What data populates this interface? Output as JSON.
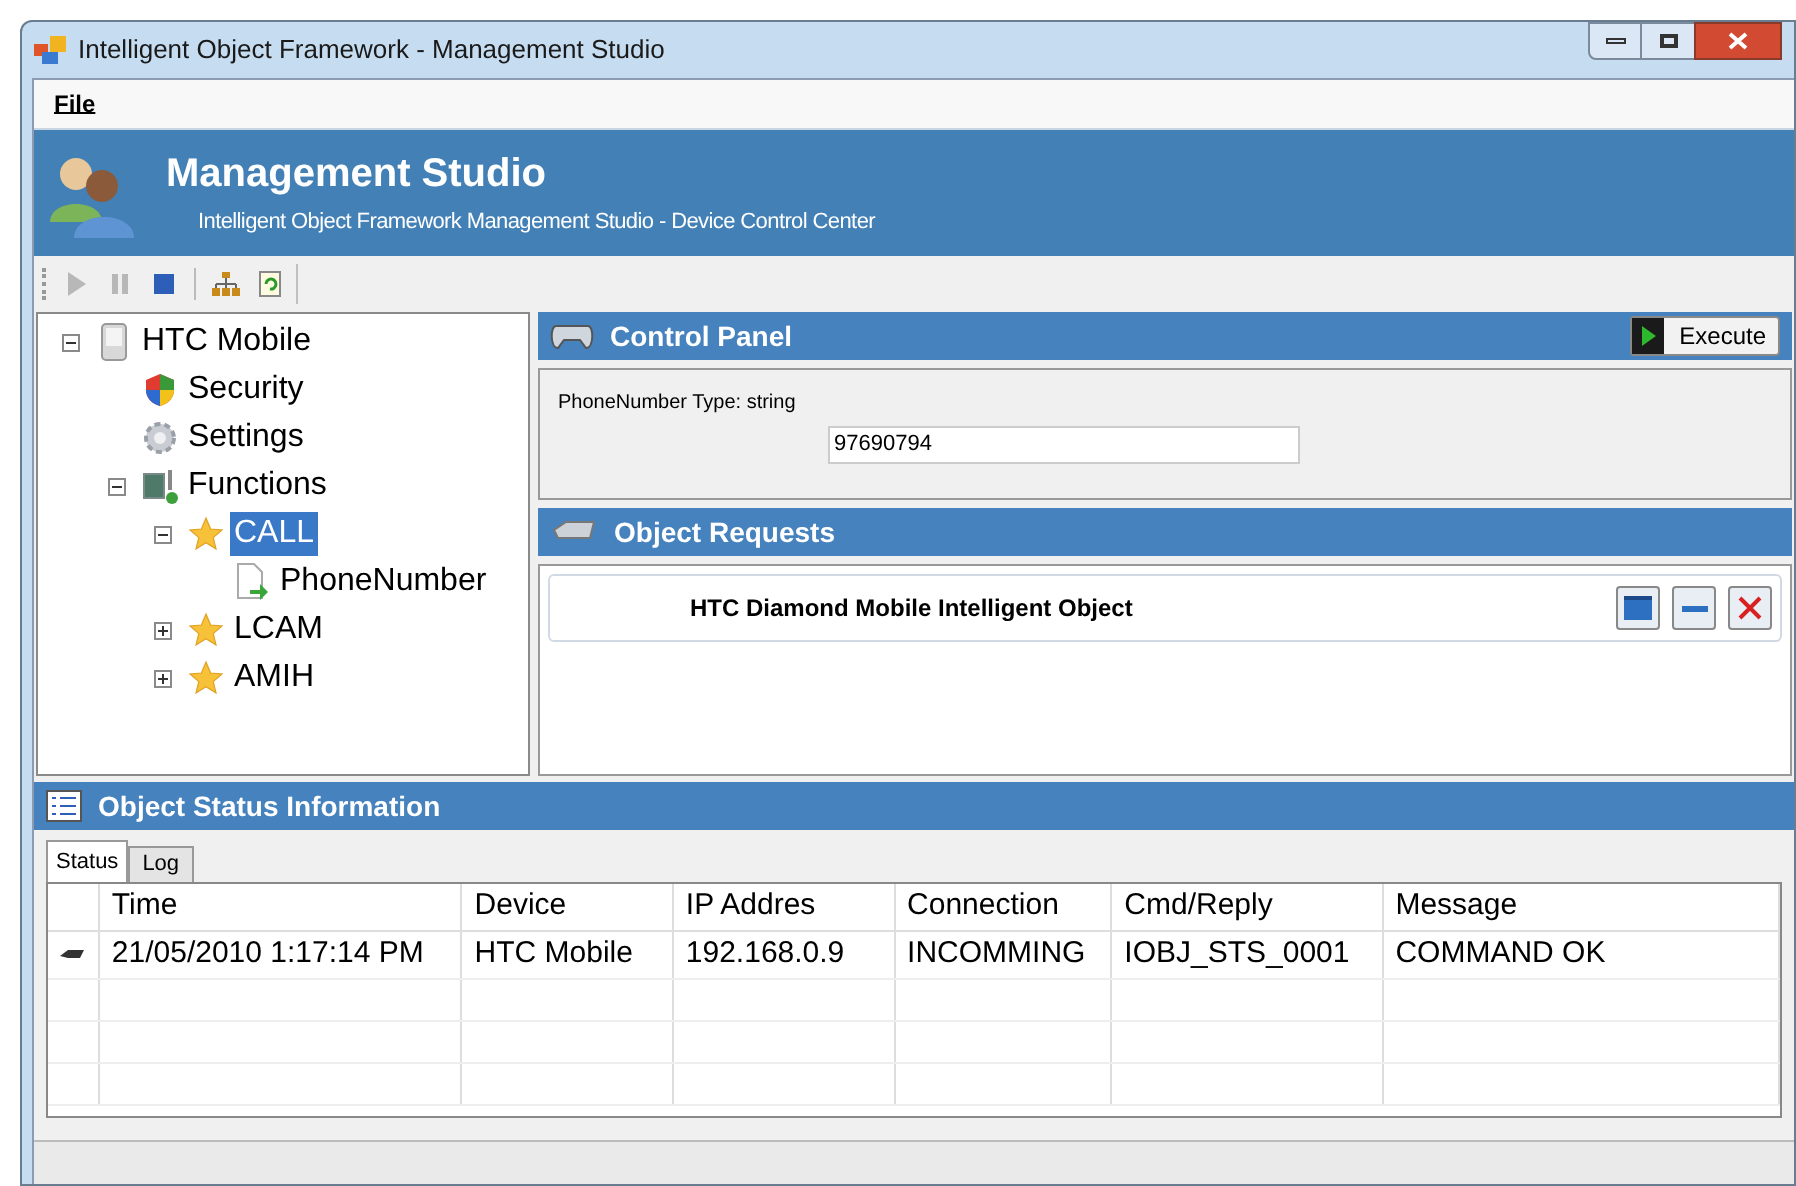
{
  "window": {
    "title": "Intelligent Object Framework - Management Studio"
  },
  "menu": [
    "File"
  ],
  "header": {
    "title": "Management Studio",
    "subtitle": "Intelligent Object Framework Management Studio - Device Control Center"
  },
  "toolbar": [
    {
      "kind": "play",
      "disabled": true
    },
    {
      "kind": "pause",
      "disabled": true
    },
    {
      "kind": "stop",
      "disabled": false
    },
    {
      "kind": "tree",
      "disabled": false
    },
    {
      "kind": "refresh",
      "disabled": false
    }
  ],
  "tree": [
    {
      "label": "HTC Mobile",
      "kind": "device",
      "expanded": true,
      "selected": false,
      "children": [
        {
          "label": "Security",
          "kind": "security",
          "selected": false
        },
        {
          "label": "Settings",
          "kind": "settings",
          "selected": false
        },
        {
          "label": "Functions",
          "kind": "functions",
          "expanded": true,
          "selected": false,
          "children": [
            {
              "label": "CALL",
              "kind": "function",
              "expanded": true,
              "selected": true,
              "children": [
                {
                  "label": "PhoneNumber",
                  "kind": "parameter",
                  "selected": false
                }
              ]
            },
            {
              "label": "LCAM",
              "kind": "function",
              "expanded": false,
              "selected": false
            },
            {
              "label": "AMIH",
              "kind": "function",
              "expanded": false,
              "selected": false
            }
          ]
        }
      ]
    }
  ],
  "control_panel": {
    "title": "Control Panel",
    "execute_button": "Execute",
    "field_label": "PhoneNumber Type: string",
    "field_value": "97690794"
  },
  "object_requests": {
    "title": "Object Requests",
    "items": [
      {
        "name": "HTC Diamond Mobile Intelligent Object"
      }
    ]
  },
  "status_panel": {
    "title": "Object Status Information",
    "tabs": [
      {
        "label": "Status",
        "selected": true
      },
      {
        "label": "Log",
        "selected": false
      }
    ],
    "table": {
      "columns": [
        "Time",
        "Device",
        "IP Addres",
        "Connection",
        "Cmd/Reply",
        "Message"
      ],
      "rows": [
        [
          "21/05/2010 1:17:14 PM",
          "HTC Mobile",
          "192.168.0.9",
          "INCOMMING",
          "IOBJ_STS_0001",
          "COMMAND OK"
        ]
      ]
    }
  }
}
